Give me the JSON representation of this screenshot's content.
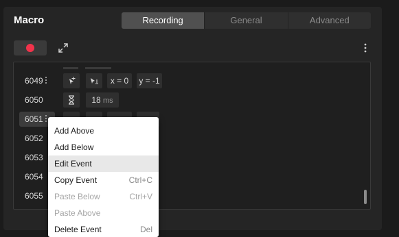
{
  "header": {
    "title": "Macro"
  },
  "tabs": [
    {
      "label": "Recording",
      "active": true
    },
    {
      "label": "General",
      "active": false
    },
    {
      "label": "Advanced",
      "active": false
    }
  ],
  "colors": {
    "record_dot": "#f2334b",
    "active_tab": "#505050",
    "panel": "#252525"
  },
  "toolbar": {
    "record_icon": "record-dot-icon",
    "expand_icon": "expand-arrows-icon",
    "more_icon": "kebab-menu-icon"
  },
  "events": [
    {
      "id": "6049",
      "type": "mouse-move",
      "x_label": "x = 0",
      "y_label": "y = -1"
    },
    {
      "id": "6050",
      "type": "delay",
      "value": "18",
      "unit": "ms"
    },
    {
      "id": "6051",
      "selected": true
    },
    {
      "id": "6052"
    },
    {
      "id": "6053"
    },
    {
      "id": "6054"
    },
    {
      "id": "6055"
    }
  ],
  "context_menu": {
    "items": [
      {
        "label": "Add Above",
        "shortcut": "",
        "disabled": false
      },
      {
        "label": "Add Below",
        "shortcut": "",
        "disabled": false
      },
      {
        "label": "Edit Event",
        "shortcut": "",
        "disabled": false,
        "highlighted": true
      },
      {
        "label": "Copy Event",
        "shortcut": "Ctrl+C",
        "disabled": false
      },
      {
        "label": "Paste Below",
        "shortcut": "Ctrl+V",
        "disabled": true
      },
      {
        "label": "Paste Above",
        "shortcut": "",
        "disabled": true
      },
      {
        "label": "Delete Event",
        "shortcut": "Del",
        "disabled": false
      }
    ]
  }
}
